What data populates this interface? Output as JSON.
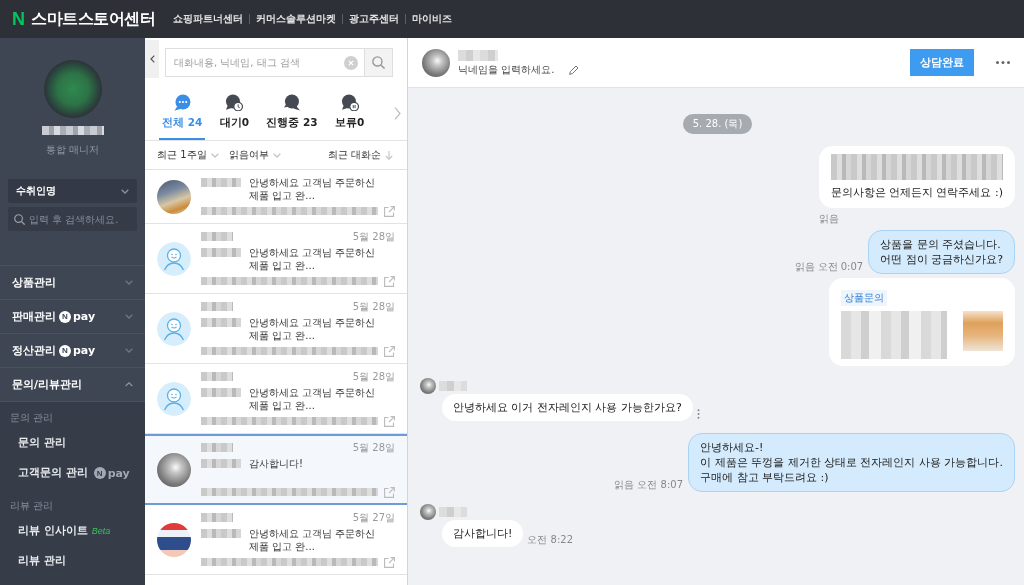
{
  "top_bar": {
    "logo": "N",
    "title": "스마트스토어센터",
    "links": [
      "쇼핑파트너센터",
      "커머스솔루션마켓",
      "광고주센터",
      "마이비즈"
    ]
  },
  "sidebar": {
    "profile": {
      "role": "통합 매니저"
    },
    "search_type": {
      "value": "수취인명"
    },
    "search": {
      "placeholder": "입력 후 검색하세요."
    },
    "menu": [
      {
        "label": "상품관리",
        "expanded": false
      },
      {
        "label": "판매관리",
        "expanded": false,
        "badge": {
          "mark": "N",
          "text": "pay"
        }
      },
      {
        "label": "정산관리",
        "expanded": false,
        "badge": {
          "mark": "N",
          "text": "pay"
        }
      },
      {
        "label": "문의/리뷰관리",
        "expanded": true,
        "groups": [
          {
            "heading": "문의 관리",
            "items": [
              {
                "label": "문의 관리"
              },
              {
                "label": "고객문의 관리",
                "badge": {
                  "mark": "N",
                  "text": "pay"
                }
              }
            ]
          },
          {
            "heading": "리뷰 관리",
            "items": [
              {
                "label": "리뷰 인사이트",
                "tag": "Beta"
              },
              {
                "label": "리뷰 관리"
              }
            ]
          }
        ]
      }
    ]
  },
  "conversation_list": {
    "search": {
      "placeholder": "대화내용, 닉네임, 태그 검색"
    },
    "tabs": [
      {
        "kind": "all",
        "label": "전체 24",
        "selected": true
      },
      {
        "kind": "waiting",
        "label": "대기0",
        "selected": false
      },
      {
        "kind": "in_progress",
        "label": "진행중 23",
        "selected": false
      },
      {
        "kind": "on_hold",
        "label": "보류0",
        "selected": false
      }
    ],
    "filters": [
      {
        "label": "최근 1주일"
      },
      {
        "label": "읽음여부"
      }
    ],
    "sort": {
      "label": "최근 대화순"
    },
    "items": [
      {
        "avatar": {
          "kind": "photo"
        },
        "preview": "안녕하세요 고객님 주문하신 제품 입고 완...",
        "selected": false
      },
      {
        "avatar": {
          "kind": "default"
        },
        "date": "5월 28일",
        "preview": "안녕하세요 고객님 주문하신 제품 입고 완...",
        "selected": false
      },
      {
        "avatar": {
          "kind": "default"
        },
        "date": "5월 28일",
        "preview": "안녕하세요 고객님 주문하신 제품 입고 완...",
        "selected": false
      },
      {
        "avatar": {
          "kind": "default"
        },
        "date": "5월 28일",
        "preview": "안녕하세요 고객님 주문하신 제품 입고 완...",
        "selected": false
      },
      {
        "avatar": {
          "kind": "sphere"
        },
        "date": "5월 28일",
        "preview": "감사합니다!",
        "selected": true
      },
      {
        "avatar": {
          "kind": "illustration"
        },
        "date": "5월 27일",
        "preview": "안녕하세요 고객님 주문하신 제품 입고 완...",
        "selected": false
      }
    ]
  },
  "chat": {
    "header": {
      "nickname": {
        "placeholder": "닉네임을 입력하세요."
      },
      "complete_button": "상담완료"
    },
    "date_divider": "5. 28. (목)",
    "messages": [
      {
        "sender": {
          "kind": "seller"
        },
        "kind": "notice",
        "text": "문의사항은 언제든지 연락주세요 :)",
        "read": "읽음"
      },
      {
        "sender": {
          "kind": "seller"
        },
        "kind": "text",
        "text": "상품을 문의 주셨습니다.\n어떤 점이 궁금하신가요?",
        "read": "읽음",
        "time": "오전 0:07"
      },
      {
        "sender": {
          "kind": "seller"
        },
        "kind": "product_card",
        "tag": "상품문의"
      },
      {
        "sender": {
          "kind": "customer"
        },
        "kind": "text",
        "text": "안녕하세요 이거 전자레인지 사용 가능한가요?",
        "more_menu": true
      },
      {
        "sender": {
          "kind": "seller"
        },
        "kind": "text",
        "text": "안녕하세요-!\n이 제품은 뚜껑을 제거한 상태로 전자레인지 사용 가능합니다.\n구매에 참고 부탁드려요 :)",
        "read": "읽음",
        "time": "오전 8:07"
      },
      {
        "sender": {
          "kind": "customer"
        },
        "kind": "text",
        "text": "감사합니다!",
        "time": "오전 8:22",
        "more_menu": false
      }
    ]
  }
}
